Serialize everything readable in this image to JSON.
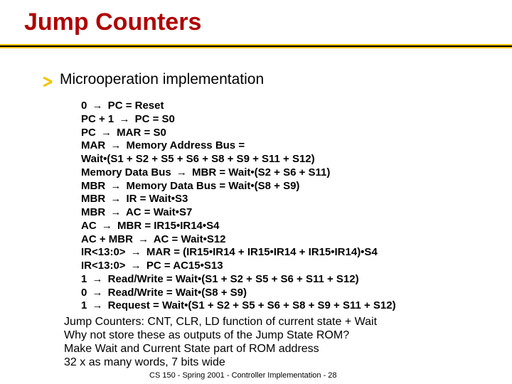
{
  "title": "Jump Counters",
  "subtitle": "Microoperation implementation",
  "arrow_glyph": "→",
  "microops": [
    {
      "lhs": "0",
      "rhs": "PC = Reset"
    },
    {
      "lhs": "PC + 1",
      "rhs": "PC = S0"
    },
    {
      "lhs": "PC",
      "rhs": "MAR = S0"
    },
    {
      "lhs": "MAR",
      "rhs": "Memory Address Bus ="
    },
    {
      "cont": " Wait•(S1 + S2 + S5 + S6 + S8 + S9 + S11 + S12)"
    },
    {
      "lhs": "Memory Data Bus",
      "rhs": "MBR = Wait•(S2 + S6 + S11)"
    },
    {
      "lhs": "MBR",
      "rhs": "Memory Data Bus = Wait•(S8 + S9)"
    },
    {
      "lhs": "MBR",
      "rhs": "IR = Wait•S3"
    },
    {
      "lhs": "MBR",
      "rhs": "AC = Wait•S7"
    },
    {
      "lhs": "AC",
      "rhs": "MBR = IR15•IR14•S4"
    },
    {
      "lhs": "AC + MBR",
      "rhs": "AC = Wait•S12"
    },
    {
      "lhs": "IR<13:0>",
      "rhs": "MAR = (IR15•IR14 + IR15•IR14 + IR15•IR14)•S4"
    },
    {
      "lhs": "IR<13:0>",
      "rhs": "PC = AC15•S13"
    },
    {
      "lhs": "1",
      "rhs": "Read/Write = Wait•(S1 + S2 + S5 + S6 + S11 + S12)"
    },
    {
      "lhs": "0",
      "rhs": "Read/Write = Wait•(S8 + S9)"
    },
    {
      "lhs": "1",
      "rhs": "Request = Wait•(S1 + S2 + S5 + S6 + S8 + S9 + S11 + S12)"
    }
  ],
  "summary_lines": [
    "Jump Counters: CNT, CLR, LD function of current state + Wait",
    "Why not store these as outputs of the Jump State ROM?",
    "Make Wait and Current State part of ROM address",
    "32 x as many words, 7 bits wide"
  ],
  "footer": "CS 150 - Spring 2001 - Controller Implementation - 28"
}
